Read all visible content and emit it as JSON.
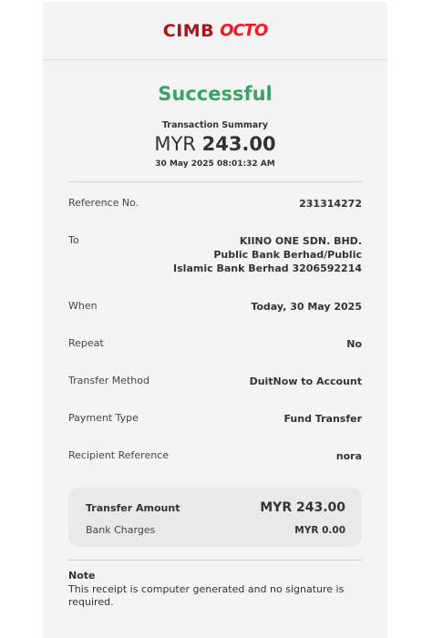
{
  "brand": {
    "name": "CIMB",
    "product": "OCTO",
    "accent": "#a5161d",
    "accent2": "#ec1c24"
  },
  "status": {
    "text": "Successful",
    "color": "#3aa563"
  },
  "summary": {
    "label": "Transaction Summary",
    "currency": "MYR",
    "amount": "243.00",
    "datetime": "30 May 2025 08:01:32 AM"
  },
  "details": {
    "reference_label": "Reference No.",
    "reference_value": "231314272",
    "to_label": "To",
    "to_line1": "KIINO ONE SDN. BHD.",
    "to_line2": "Public Bank Berhad/Public",
    "to_line3": "Islamic Bank Berhad 3206592214",
    "when_label": "When",
    "when_value": "Today, 30 May 2025",
    "repeat_label": "Repeat",
    "repeat_value": "No",
    "method_label": "Transfer Method",
    "method_value": "DuitNow to Account",
    "payment_type_label": "Payment Type",
    "payment_type_value": "Fund Transfer",
    "recipient_ref_label": "Recipient Reference",
    "recipient_ref_value": "nora"
  },
  "totals": {
    "transfer_amount_label": "Transfer Amount",
    "transfer_amount_value": "MYR 243.00",
    "bank_charges_label": "Bank Charges",
    "bank_charges_value": "MYR 0.00"
  },
  "note": {
    "title": "Note",
    "text": "This receipt is computer generated and no signature is required."
  }
}
